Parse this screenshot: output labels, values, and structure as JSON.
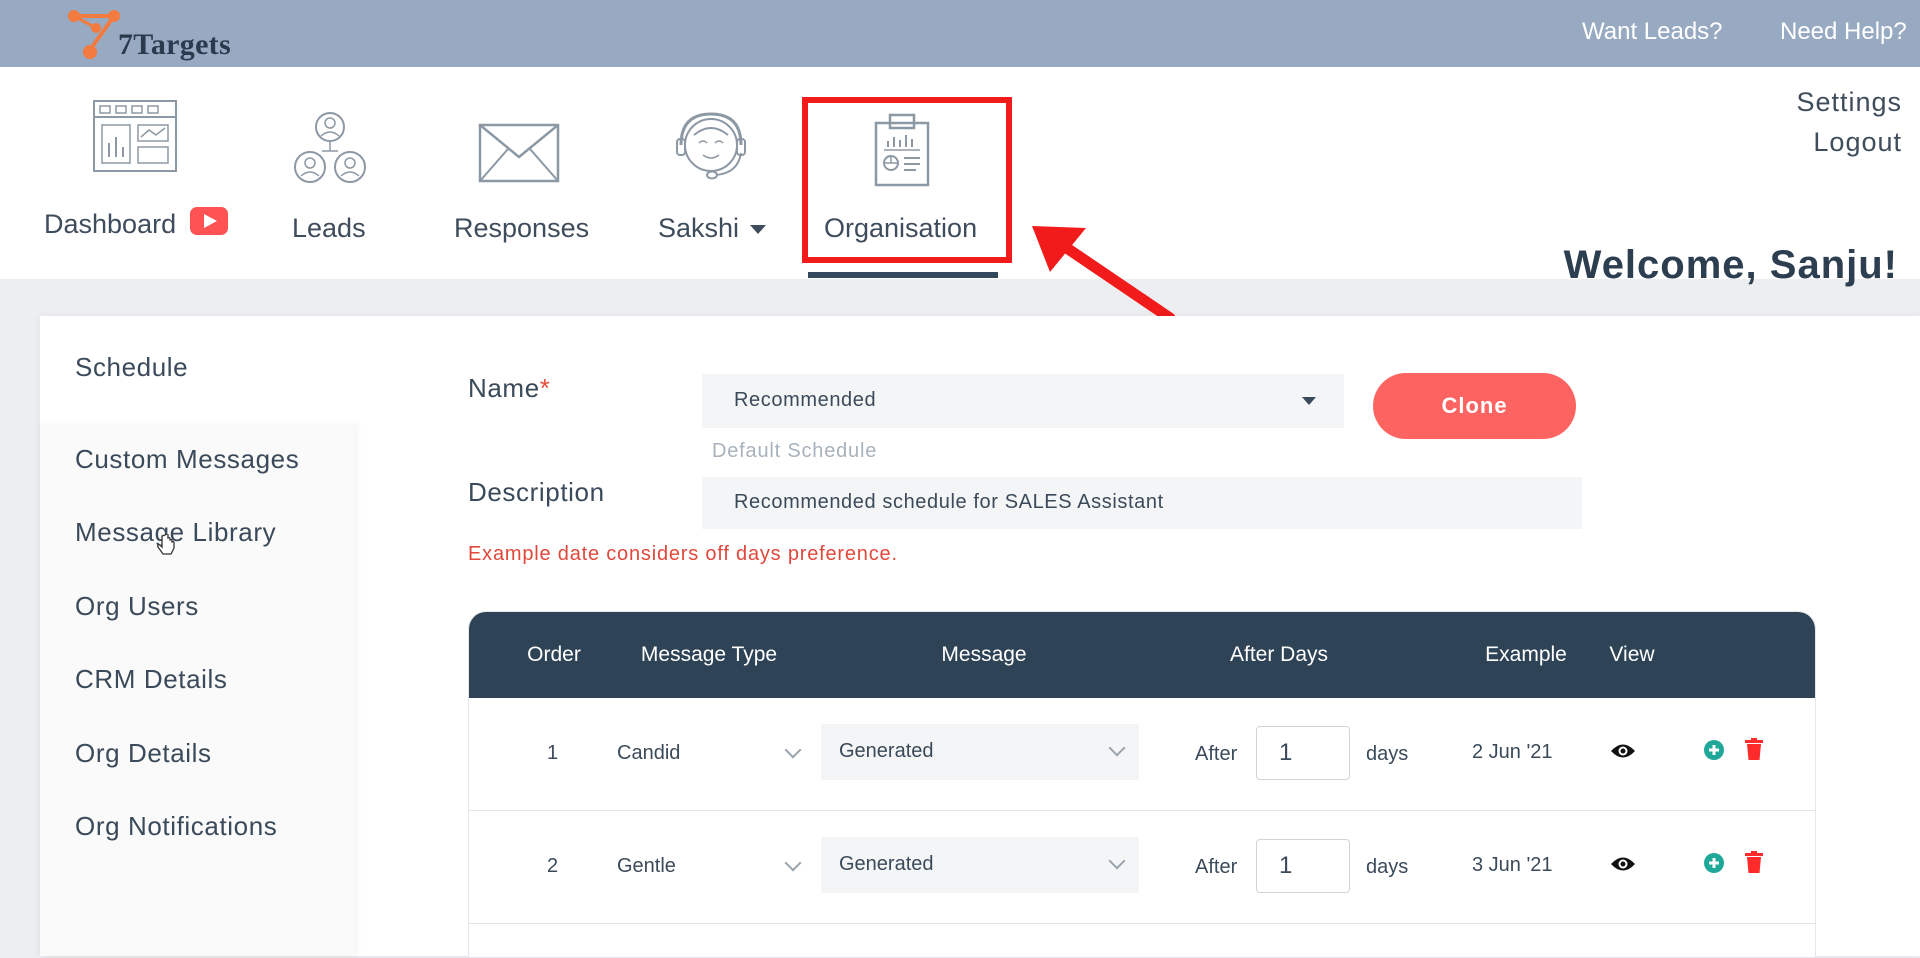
{
  "app": {
    "logo_text": "7Targets"
  },
  "topbar": {
    "want_leads": "Want Leads?",
    "need_help": "Need Help?"
  },
  "nav": {
    "items": [
      {
        "label": "Dashboard",
        "icon": "dashboard-icon"
      },
      {
        "label": "Leads",
        "icon": "leads-icon"
      },
      {
        "label": "Responses",
        "icon": "envelope-icon"
      },
      {
        "label": "Sakshi",
        "icon": "headset-assistant-icon"
      },
      {
        "label": "Organisation",
        "icon": "clipboard-report-icon"
      }
    ],
    "active": "Organisation",
    "settings": "Settings",
    "logout": "Logout",
    "welcome": "Welcome, Sanju!"
  },
  "sidebar": {
    "items": [
      {
        "label": "Schedule"
      },
      {
        "label": "Custom Messages"
      },
      {
        "label": "Message Library"
      },
      {
        "label": "Org Users"
      },
      {
        "label": "CRM Details"
      },
      {
        "label": "Org Details"
      },
      {
        "label": "Org Notifications"
      }
    ]
  },
  "form": {
    "name_label": "Name",
    "required_mark": "*",
    "name_value": "Recommended",
    "clone_label": "Clone",
    "name_hint": "Default Schedule",
    "description_label": "Description",
    "description_value": "Recommended schedule for SALES Assistant",
    "note": "Example date considers off days preference."
  },
  "table": {
    "headers": [
      "Order",
      "Message Type",
      "Message",
      "After Days",
      "Example",
      "View"
    ],
    "rows": [
      {
        "order": "1",
        "type": "Candid",
        "message": "Generated",
        "after": "After",
        "days_value": "1",
        "days": "days",
        "example": "2 Jun '21"
      },
      {
        "order": "2",
        "type": "Gentle",
        "message": "Generated",
        "after": "After",
        "days_value": "1",
        "days": "days",
        "example": "3 Jun '21"
      }
    ]
  },
  "colors": {
    "topbar": "#97aac2",
    "accent": "#fd6360",
    "table_header": "#2e4356",
    "highlight": "#f11b1b",
    "add_icon": "#1fa89a",
    "delete_icon": "#ff2b2b"
  }
}
